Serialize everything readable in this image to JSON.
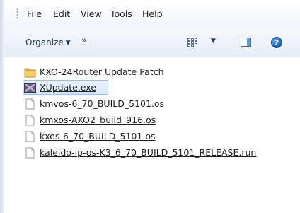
{
  "menu": [
    "File",
    "Edit",
    "View",
    "Tools",
    "Help"
  ],
  "toolbar": {
    "organize": "Organize",
    "organize_arrow": "▼",
    "overflow": "»",
    "views_arrow": "▼",
    "help_glyph": "?"
  },
  "icons": {
    "views": "views-icon",
    "preview_pane": "preview-pane-icon",
    "help": "help-icon"
  },
  "files": [
    {
      "name": "KXO-24Router Update Patch",
      "type": "folder",
      "selected": false
    },
    {
      "name": "XUpdate.exe",
      "type": "exe",
      "selected": true
    },
    {
      "name": "kmvos-6_70_BUILD_5101.os",
      "type": "file",
      "selected": false
    },
    {
      "name": "kmxos-AXO2_build_916.os",
      "type": "file",
      "selected": false
    },
    {
      "name": "kxos-6_70_BUILD_5101.os",
      "type": "file",
      "selected": false
    },
    {
      "name": "kaleido-ip-os-K3_6_70_BUILD_5101_RELEASE.run",
      "type": "file",
      "selected": false
    }
  ],
  "colors": {
    "selection_fill": "#d6e8fb",
    "selection_border": "#9cc3ee",
    "folder": "#e8b94a",
    "toolbar_text": "#1e3c5c"
  }
}
